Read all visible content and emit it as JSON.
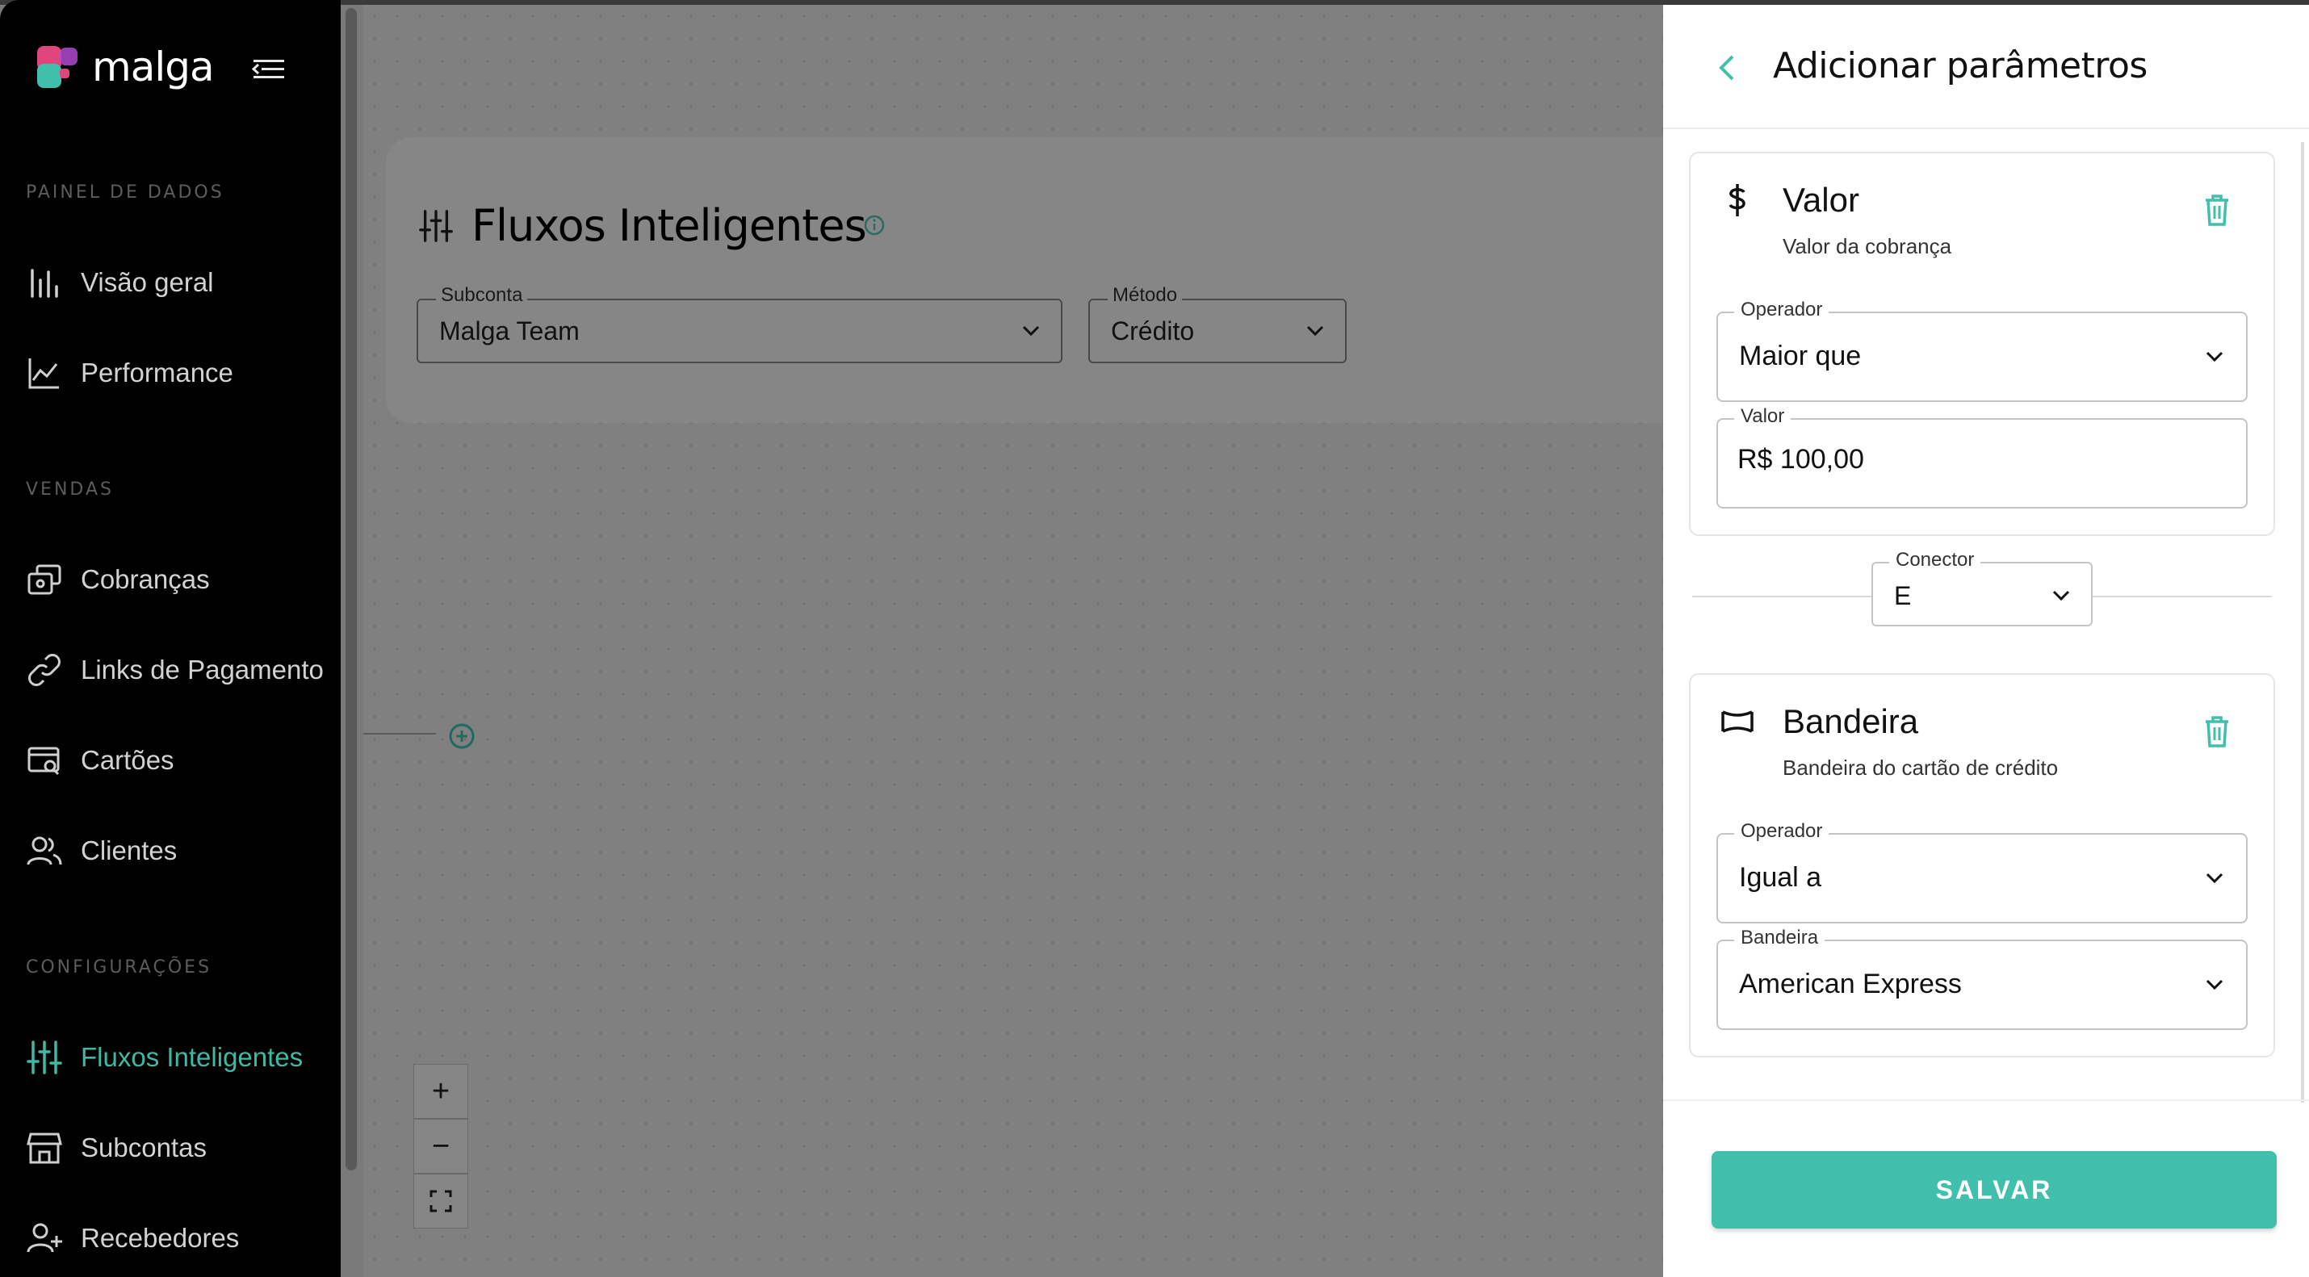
{
  "app": {
    "brand": "malga"
  },
  "sidebar": {
    "sections": [
      {
        "title": "PAINEL DE DADOS"
      },
      {
        "title": "VENDAS"
      },
      {
        "title": "CONFIGURAÇÕES"
      }
    ],
    "items": [
      {
        "label": "Visão geral",
        "icon": "bar-chart-icon"
      },
      {
        "label": "Performance",
        "icon": "line-chart-icon"
      },
      {
        "label": "Cobranças",
        "icon": "charges-icon"
      },
      {
        "label": "Links de Pagamento",
        "icon": "link-icon"
      },
      {
        "label": "Cartões",
        "icon": "card-search-icon"
      },
      {
        "label": "Clientes",
        "icon": "users-icon"
      },
      {
        "label": "Fluxos Inteligentes",
        "icon": "sliders-icon",
        "active": true
      },
      {
        "label": "Subcontas",
        "icon": "store-icon"
      },
      {
        "label": "Recebedores",
        "icon": "user-plus-icon"
      }
    ]
  },
  "main": {
    "title": "Fluxos Inteligentes",
    "filters": {
      "subconta": {
        "label": "Subconta",
        "value": "Malga Team"
      },
      "metodo": {
        "label": "Método",
        "value": "Crédito"
      }
    },
    "zoom": {
      "in": "+",
      "out": "−"
    }
  },
  "drawer": {
    "title": "Adicionar parâmetros",
    "cards": [
      {
        "title": "Valor",
        "subtitle": "Valor da cobrança",
        "icon": "dollar-icon",
        "fields": [
          {
            "label": "Operador",
            "value": "Maior que"
          },
          {
            "label": "Valor",
            "value": "R$ 100,00"
          }
        ]
      },
      {
        "title": "Bandeira",
        "subtitle": "Bandeira do cartão de crédito",
        "icon": "flag-icon",
        "fields": [
          {
            "label": "Operador",
            "value": "Igual a"
          },
          {
            "label": "Bandeira",
            "value": "American Express"
          }
        ]
      }
    ],
    "connector": {
      "label": "Conector",
      "value": "E"
    },
    "save_label": "SALVAR"
  },
  "colors": {
    "accent": "#3fbfac",
    "sidebar_bg": "#000000",
    "overlay": "#7a7a7a"
  }
}
